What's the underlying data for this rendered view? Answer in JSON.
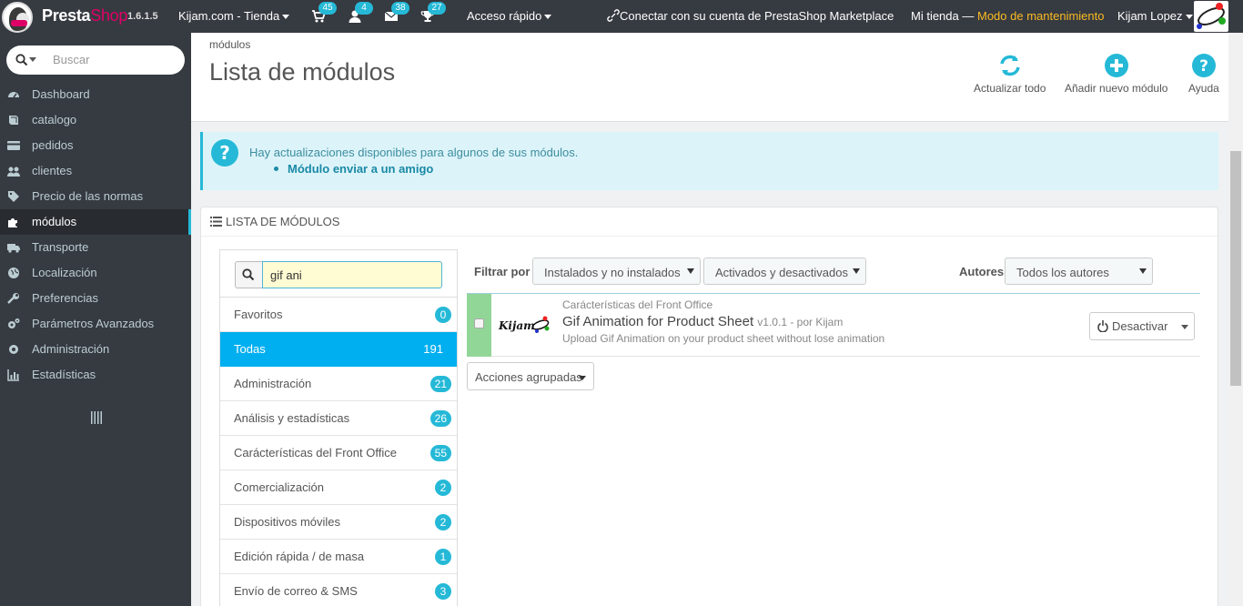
{
  "topbar": {
    "brand_presta": "Presta",
    "brand_shop": "Shop",
    "version": "1.6.1.5",
    "store_name": "Kijam.com - Tienda",
    "orders_count": "45",
    "customers_count": "4",
    "messages_count": "38",
    "trophy_count": "27",
    "quick_access": "Acceso rápido",
    "marketplace": "Conectar con su cuenta de PrestaShop Marketplace",
    "my_store": "Mi tienda",
    "dash": "—",
    "maintenance": "Modo de mantenimiento",
    "user": "Kijam Lopez"
  },
  "sidebar": {
    "search_placeholder": "Buscar",
    "items": [
      {
        "label": "Dashboard",
        "icon": "dashboard-icon"
      },
      {
        "label": "catalogo",
        "icon": "book-icon"
      },
      {
        "label": "pedidos",
        "icon": "credit-card-icon"
      },
      {
        "label": "clientes",
        "icon": "users-icon"
      },
      {
        "label": "Precio de las normas",
        "icon": "tags-icon"
      },
      {
        "label": "módulos",
        "icon": "puzzle-icon"
      },
      {
        "label": "Transporte",
        "icon": "truck-icon"
      },
      {
        "label": "Localización",
        "icon": "globe-icon"
      },
      {
        "label": "Preferencias",
        "icon": "wrench-icon"
      },
      {
        "label": "Parámetros Avanzados",
        "icon": "cogs-icon"
      },
      {
        "label": "Administración",
        "icon": "cog-icon"
      },
      {
        "label": "Estadísticas",
        "icon": "bar-chart-icon"
      }
    ]
  },
  "header": {
    "breadcrumb": "módulos",
    "title": "Lista de módulos",
    "toolbar": {
      "update_all": "Actualizar todo",
      "add_module": "Añadir nuevo módulo",
      "help": "Ayuda"
    }
  },
  "alert": {
    "message": "Hay actualizaciones disponibles para algunos de sus módulos.",
    "module_link": "Módulo enviar a un amigo"
  },
  "panel": {
    "title": "LISTA DE MÓDULOS",
    "search_value": "gif ani",
    "categories": [
      {
        "label": "Favoritos",
        "count": "0"
      },
      {
        "label": "Todas",
        "count": "191"
      },
      {
        "label": "Administración",
        "count": "21"
      },
      {
        "label": "Análisis y estadísticas",
        "count": "26"
      },
      {
        "label": "Carácterísticas del Front Office",
        "count": "55"
      },
      {
        "label": "Comercialización",
        "count": "2"
      },
      {
        "label": "Dispositivos móviles",
        "count": "2"
      },
      {
        "label": "Edición rápida / de masa",
        "count": "1"
      },
      {
        "label": "Envío de correo & SMS",
        "count": "3"
      }
    ],
    "filters": {
      "filter_by": "Filtrar por",
      "install_select": "Instalados y no instalados",
      "active_select": "Activados y desactivados",
      "authors_label": "Autores",
      "authors_select": "Todos los autores"
    },
    "module": {
      "category": "Carácterísticas del Front Office",
      "name": "Gif Animation for Product Sheet",
      "version": "v1.0.1 - por Kijam",
      "description": "Upload Gif Animation on your product sheet without lose animation",
      "action": "Desactivar",
      "logo_text": "Kijam"
    },
    "bulk_actions": "Acciones agrupadas"
  },
  "colors": {
    "topbar_bg": "#363a41",
    "accent": "#25b9d7",
    "active_category": "#00aff0",
    "maintenance": "#fbbb22",
    "installed_marker": "#92d697"
  }
}
